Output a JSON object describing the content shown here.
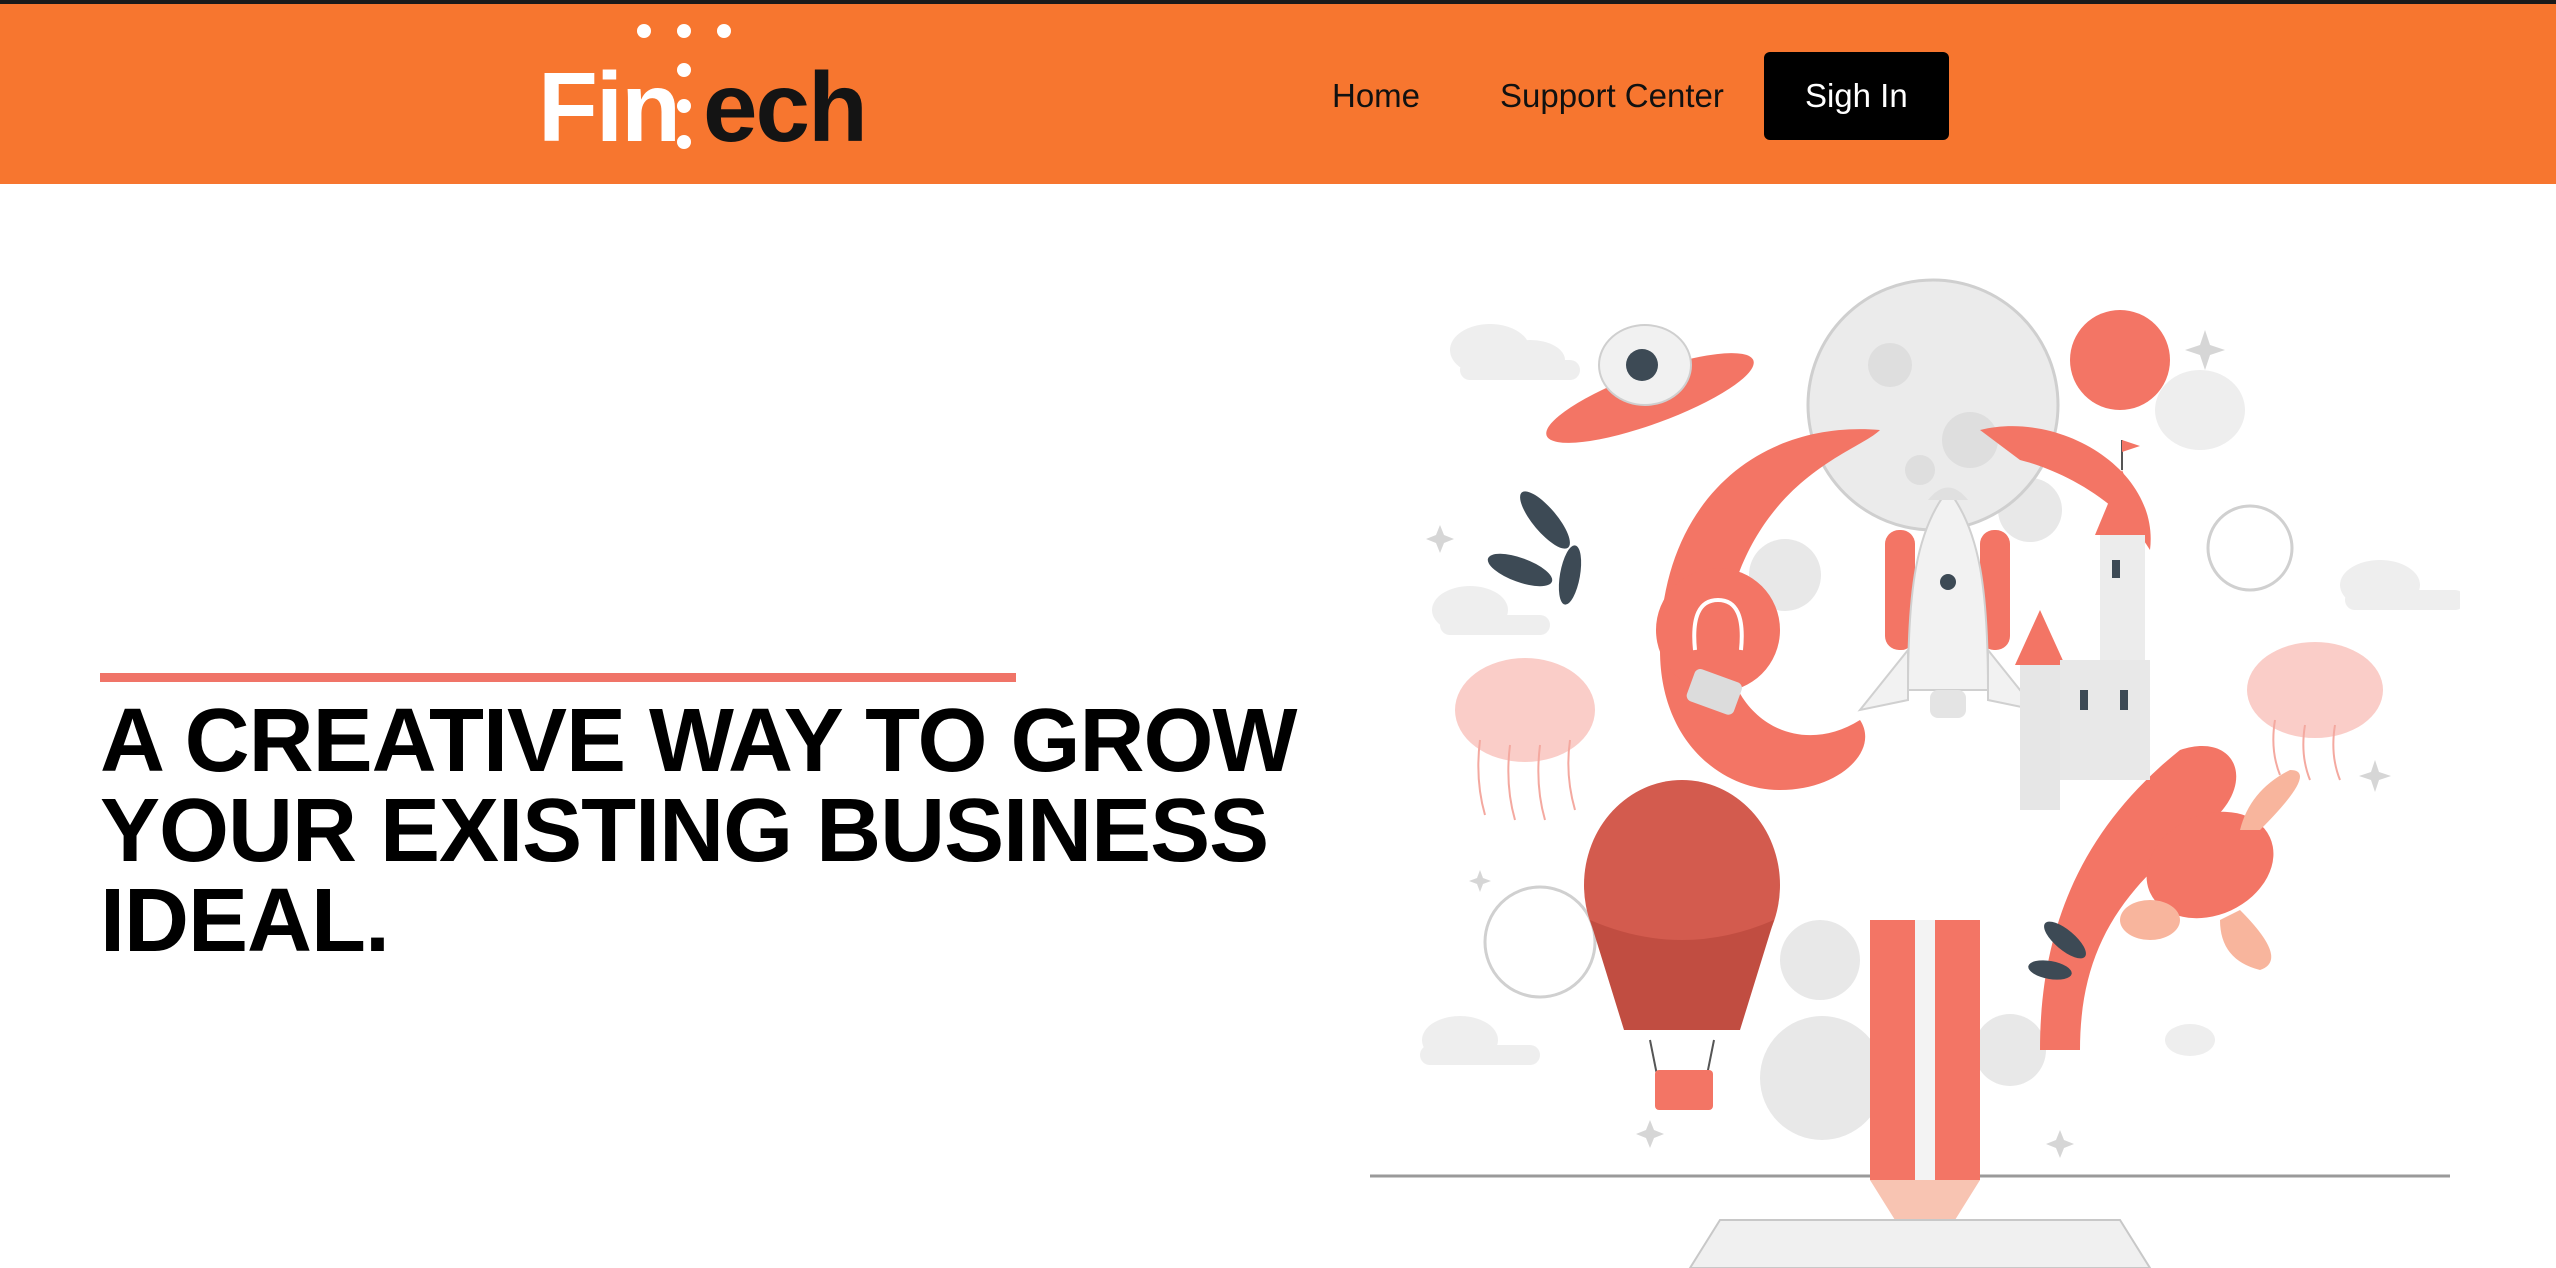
{
  "brand": {
    "logo_text_light": "Fin",
    "logo_text_dark": "ech",
    "primary_color": "#f7762f",
    "accent_color": "#f07468"
  },
  "nav": {
    "home_label": "Home",
    "support_label": "Support Center",
    "signin_label": "Sigh In"
  },
  "hero": {
    "headline": "A CREATIVE WAY TO GROW YOUR EXISTING BUSINESS IDEAL."
  },
  "illustration": {
    "icon": "creative-space-pencil-illustration"
  }
}
